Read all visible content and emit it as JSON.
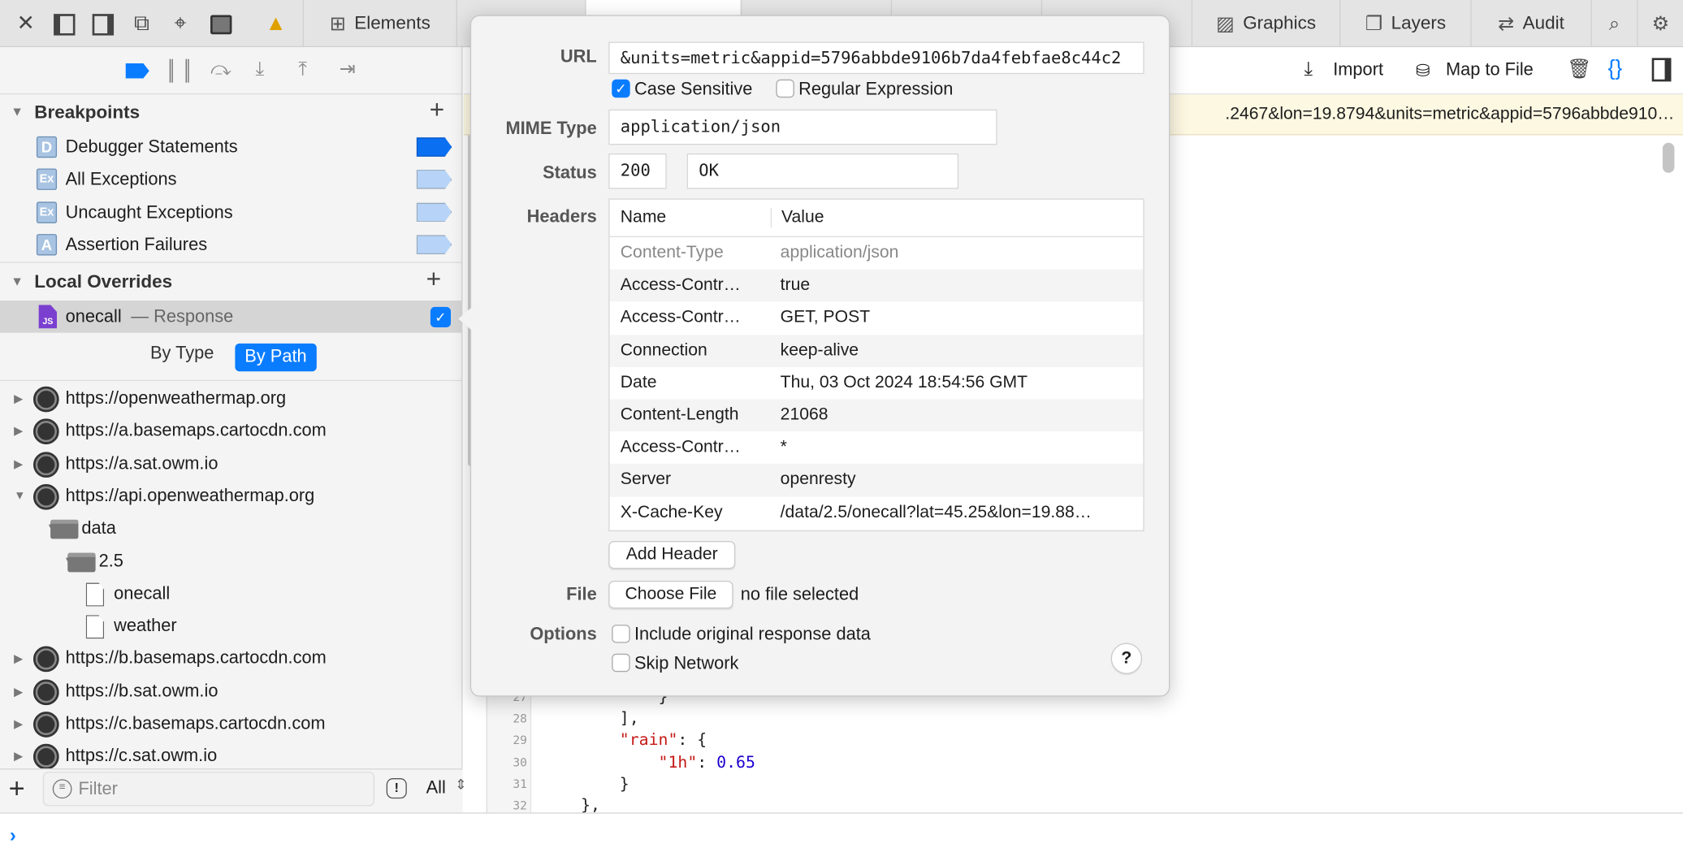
{
  "tabbar": {
    "icons": [
      "close-icon",
      "dock-left-icon",
      "dock-right-icon",
      "undock-icon",
      "inspect-icon",
      "device-icon",
      "warning-icon"
    ],
    "tabs": [
      {
        "label": "Elements",
        "icon": "elements-icon"
      },
      {
        "label": "Graphics",
        "icon": "graphics-icon"
      },
      {
        "label": "Layers",
        "icon": "layers-icon"
      },
      {
        "label": "Audit",
        "icon": "audit-icon"
      }
    ],
    "accent": "#0a7cff"
  },
  "sidebar": {
    "breakpoints": {
      "title": "Breakpoints",
      "items": [
        {
          "label": "Debugger Statements",
          "icon": "D",
          "active": true
        },
        {
          "label": "All Exceptions",
          "icon": "Ex",
          "active": false
        },
        {
          "label": "Uncaught Exceptions",
          "icon": "Ex",
          "active": false
        },
        {
          "label": "Assertion Failures",
          "icon": "A",
          "active": false
        }
      ]
    },
    "overrides": {
      "title": "Local Overrides",
      "item_name": "onecall",
      "item_sep": "—",
      "item_kind": "Response",
      "file_badge": "JS",
      "checked": true
    },
    "grouping": {
      "by_type": "By Type",
      "by_path": "By Path",
      "selected": "By Path"
    },
    "tree": [
      {
        "label": "https://openweathermap.org",
        "type": "origin",
        "level": 0,
        "expanded": false
      },
      {
        "label": "https://a.basemaps.cartocdn.com",
        "type": "origin",
        "level": 0,
        "expanded": false
      },
      {
        "label": "https://a.sat.owm.io",
        "type": "origin",
        "level": 0,
        "expanded": false
      },
      {
        "label": "https://api.openweathermap.org",
        "type": "origin",
        "level": 0,
        "expanded": true
      },
      {
        "label": "data",
        "type": "folder",
        "level": 1,
        "expanded": true
      },
      {
        "label": "2.5",
        "type": "folder",
        "level": 2,
        "expanded": true
      },
      {
        "label": "onecall",
        "type": "file",
        "level": 3
      },
      {
        "label": "weather",
        "type": "file",
        "level": 3
      },
      {
        "label": "https://b.basemaps.cartocdn.com",
        "type": "origin",
        "level": 0,
        "expanded": false
      },
      {
        "label": "https://b.sat.owm.io",
        "type": "origin",
        "level": 0,
        "expanded": false
      },
      {
        "label": "https://c.basemaps.cartocdn.com",
        "type": "origin",
        "level": 0,
        "expanded": false
      },
      {
        "label": "https://c.sat.owm.io",
        "type": "origin",
        "level": 0,
        "expanded": false
      }
    ],
    "filter_placeholder": "Filter",
    "scope": "All"
  },
  "main": {
    "toolbar": {
      "import": "Import",
      "map_to_file": "Map to File"
    },
    "url_banner": ".2467&lon=19.8794&units=metric&appid=5796abbde910…",
    "code_lines": [
      {
        "n": "27",
        "text": "            }"
      },
      {
        "n": "28",
        "text": "        ],"
      },
      {
        "n": "29",
        "key": "\"rain\"",
        "rest": ": {",
        "indent": "        "
      },
      {
        "n": "30",
        "key": "\"1h\"",
        "rest": ": ",
        "num": "0.65",
        "indent": "            "
      },
      {
        "n": "31",
        "text": "        }"
      },
      {
        "n": "32",
        "text": "    },"
      }
    ]
  },
  "popover": {
    "url_label": "URL",
    "url_value": "&units=metric&appid=5796abbde9106b7da4febfae8c44c2",
    "case_sensitive": {
      "label": "Case Sensitive",
      "checked": true
    },
    "regex": {
      "label": "Regular Expression",
      "checked": false
    },
    "mime_label": "MIME Type",
    "mime_value": "application/json",
    "status_label": "Status",
    "status_code": "200",
    "status_text": "OK",
    "headers_label": "Headers",
    "headers_columns": [
      "Name",
      "Value"
    ],
    "headers": [
      {
        "name": "Content-Type",
        "value": "application/json",
        "placeholder": true
      },
      {
        "name": "Access-Contr…",
        "value": "true"
      },
      {
        "name": "Access-Contr…",
        "value": "GET, POST"
      },
      {
        "name": "Connection",
        "value": "keep-alive"
      },
      {
        "name": "Date",
        "value": "Thu, 03 Oct 2024 18:54:56 GMT"
      },
      {
        "name": "Content-Length",
        "value": "21068"
      },
      {
        "name": "Access-Contr…",
        "value": "*"
      },
      {
        "name": "Server",
        "value": "openresty"
      },
      {
        "name": "X-Cache-Key",
        "value": "/data/2.5/onecall?lat=45.25&lon=19.88…"
      }
    ],
    "add_header": "Add Header",
    "file_label": "File",
    "choose_file": "Choose File",
    "no_file": "no file selected",
    "options_label": "Options",
    "include_original": {
      "label": "Include original response data",
      "checked": false
    },
    "skip_network": {
      "label": "Skip Network",
      "checked": false
    },
    "help": "?"
  }
}
